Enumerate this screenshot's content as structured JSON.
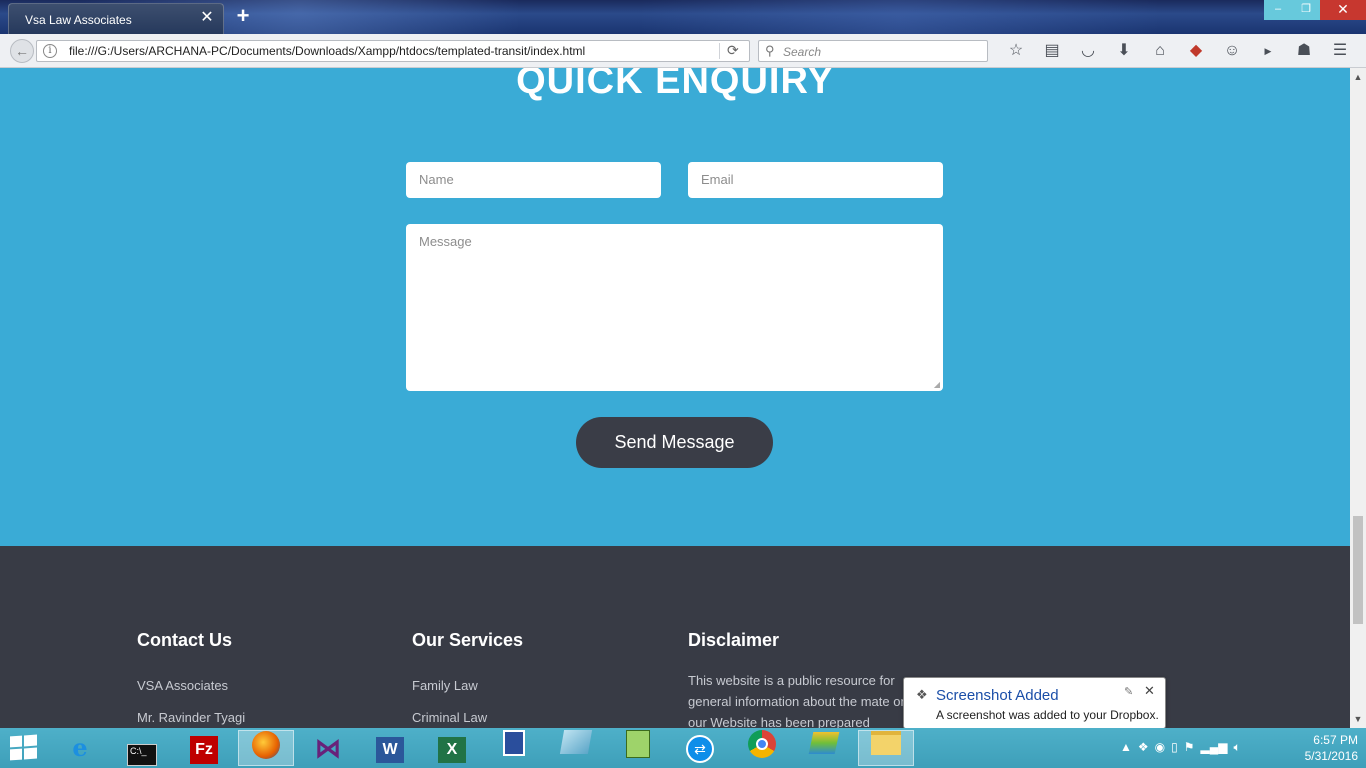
{
  "browser": {
    "tab_title": "Vsa Law Associates",
    "tab_close": "✕",
    "new_tab": "+",
    "url": "file:///G:/Users/ARCHANA-PC/Documents/Downloads/Xampp/htdocs/templated-transit/index.html",
    "search_placeholder": "Search",
    "window_buttons": [
      "–",
      "❐",
      "✕"
    ],
    "toolbar_icons": [
      "star-icon",
      "reading-list-icon",
      "pocket-icon",
      "download-icon",
      "home-icon",
      "extension-icon",
      "emoji-icon",
      "youtube-icon",
      "profile-icon",
      "menu-icon"
    ]
  },
  "page": {
    "heading": "QUICK ENQUIRY",
    "form": {
      "name_placeholder": "Name",
      "email_placeholder": "Email",
      "message_placeholder": "Message",
      "send_label": "Send Message"
    },
    "footer": {
      "contact": {
        "title": "Contact Us",
        "items": [
          "VSA Associates",
          "Mr. Ravinder Tyagi"
        ]
      },
      "services": {
        "title": "Our Services",
        "items": [
          "Family Law",
          "Criminal Law"
        ]
      },
      "disclaimer": {
        "title": "Disclaimer",
        "text": "This website is a public resource for general information about the mate on our Website has been prepared"
      }
    }
  },
  "notification": {
    "title": "Screenshot Added",
    "body": "A screenshot was added to your Dropbox."
  },
  "taskbar": {
    "apps": [
      "internet-explorer-icon",
      "cmd-icon",
      "filezilla-icon",
      "firefox-icon",
      "visual-studio-icon",
      "word-icon",
      "excel-icon",
      "app-icon",
      "paint-icon",
      "notepad-icon",
      "teamviewer-icon",
      "chrome-icon",
      "bluestacks-icon",
      "file-explorer-icon"
    ],
    "time": "6:57 PM",
    "date": "5/31/2016"
  },
  "colors": {
    "page_bg": "#3aabd6",
    "footer_bg": "#383b45",
    "button_bg": "#3a3d47",
    "taskbar": "#4eb0c9"
  }
}
